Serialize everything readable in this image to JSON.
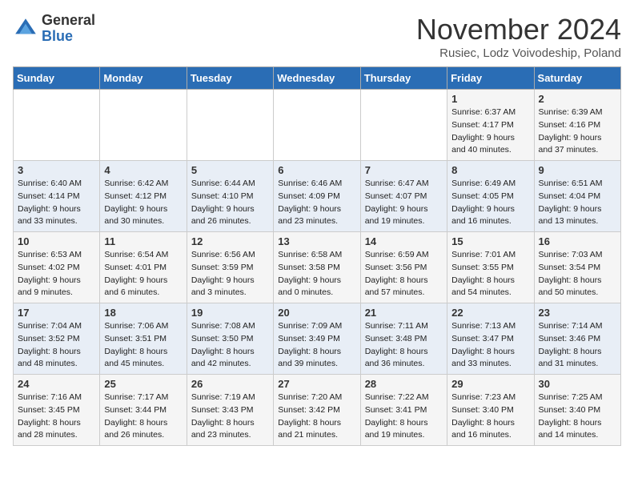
{
  "logo": {
    "general": "General",
    "blue": "Blue"
  },
  "header": {
    "month": "November 2024",
    "location": "Rusiec, Lodz Voivodeship, Poland"
  },
  "days_of_week": [
    "Sunday",
    "Monday",
    "Tuesday",
    "Wednesday",
    "Thursday",
    "Friday",
    "Saturday"
  ],
  "weeks": [
    [
      {
        "day": "",
        "info": ""
      },
      {
        "day": "",
        "info": ""
      },
      {
        "day": "",
        "info": ""
      },
      {
        "day": "",
        "info": ""
      },
      {
        "day": "",
        "info": ""
      },
      {
        "day": "1",
        "info": "Sunrise: 6:37 AM\nSunset: 4:17 PM\nDaylight: 9 hours\nand 40 minutes."
      },
      {
        "day": "2",
        "info": "Sunrise: 6:39 AM\nSunset: 4:16 PM\nDaylight: 9 hours\nand 37 minutes."
      }
    ],
    [
      {
        "day": "3",
        "info": "Sunrise: 6:40 AM\nSunset: 4:14 PM\nDaylight: 9 hours\nand 33 minutes."
      },
      {
        "day": "4",
        "info": "Sunrise: 6:42 AM\nSunset: 4:12 PM\nDaylight: 9 hours\nand 30 minutes."
      },
      {
        "day": "5",
        "info": "Sunrise: 6:44 AM\nSunset: 4:10 PM\nDaylight: 9 hours\nand 26 minutes."
      },
      {
        "day": "6",
        "info": "Sunrise: 6:46 AM\nSunset: 4:09 PM\nDaylight: 9 hours\nand 23 minutes."
      },
      {
        "day": "7",
        "info": "Sunrise: 6:47 AM\nSunset: 4:07 PM\nDaylight: 9 hours\nand 19 minutes."
      },
      {
        "day": "8",
        "info": "Sunrise: 6:49 AM\nSunset: 4:05 PM\nDaylight: 9 hours\nand 16 minutes."
      },
      {
        "day": "9",
        "info": "Sunrise: 6:51 AM\nSunset: 4:04 PM\nDaylight: 9 hours\nand 13 minutes."
      }
    ],
    [
      {
        "day": "10",
        "info": "Sunrise: 6:53 AM\nSunset: 4:02 PM\nDaylight: 9 hours\nand 9 minutes."
      },
      {
        "day": "11",
        "info": "Sunrise: 6:54 AM\nSunset: 4:01 PM\nDaylight: 9 hours\nand 6 minutes."
      },
      {
        "day": "12",
        "info": "Sunrise: 6:56 AM\nSunset: 3:59 PM\nDaylight: 9 hours\nand 3 minutes."
      },
      {
        "day": "13",
        "info": "Sunrise: 6:58 AM\nSunset: 3:58 PM\nDaylight: 9 hours\nand 0 minutes."
      },
      {
        "day": "14",
        "info": "Sunrise: 6:59 AM\nSunset: 3:56 PM\nDaylight: 8 hours\nand 57 minutes."
      },
      {
        "day": "15",
        "info": "Sunrise: 7:01 AM\nSunset: 3:55 PM\nDaylight: 8 hours\nand 54 minutes."
      },
      {
        "day": "16",
        "info": "Sunrise: 7:03 AM\nSunset: 3:54 PM\nDaylight: 8 hours\nand 50 minutes."
      }
    ],
    [
      {
        "day": "17",
        "info": "Sunrise: 7:04 AM\nSunset: 3:52 PM\nDaylight: 8 hours\nand 48 minutes."
      },
      {
        "day": "18",
        "info": "Sunrise: 7:06 AM\nSunset: 3:51 PM\nDaylight: 8 hours\nand 45 minutes."
      },
      {
        "day": "19",
        "info": "Sunrise: 7:08 AM\nSunset: 3:50 PM\nDaylight: 8 hours\nand 42 minutes."
      },
      {
        "day": "20",
        "info": "Sunrise: 7:09 AM\nSunset: 3:49 PM\nDaylight: 8 hours\nand 39 minutes."
      },
      {
        "day": "21",
        "info": "Sunrise: 7:11 AM\nSunset: 3:48 PM\nDaylight: 8 hours\nand 36 minutes."
      },
      {
        "day": "22",
        "info": "Sunrise: 7:13 AM\nSunset: 3:47 PM\nDaylight: 8 hours\nand 33 minutes."
      },
      {
        "day": "23",
        "info": "Sunrise: 7:14 AM\nSunset: 3:46 PM\nDaylight: 8 hours\nand 31 minutes."
      }
    ],
    [
      {
        "day": "24",
        "info": "Sunrise: 7:16 AM\nSunset: 3:45 PM\nDaylight: 8 hours\nand 28 minutes."
      },
      {
        "day": "25",
        "info": "Sunrise: 7:17 AM\nSunset: 3:44 PM\nDaylight: 8 hours\nand 26 minutes."
      },
      {
        "day": "26",
        "info": "Sunrise: 7:19 AM\nSunset: 3:43 PM\nDaylight: 8 hours\nand 23 minutes."
      },
      {
        "day": "27",
        "info": "Sunrise: 7:20 AM\nSunset: 3:42 PM\nDaylight: 8 hours\nand 21 minutes."
      },
      {
        "day": "28",
        "info": "Sunrise: 7:22 AM\nSunset: 3:41 PM\nDaylight: 8 hours\nand 19 minutes."
      },
      {
        "day": "29",
        "info": "Sunrise: 7:23 AM\nSunset: 3:40 PM\nDaylight: 8 hours\nand 16 minutes."
      },
      {
        "day": "30",
        "info": "Sunrise: 7:25 AM\nSunset: 3:40 PM\nDaylight: 8 hours\nand 14 minutes."
      }
    ]
  ]
}
